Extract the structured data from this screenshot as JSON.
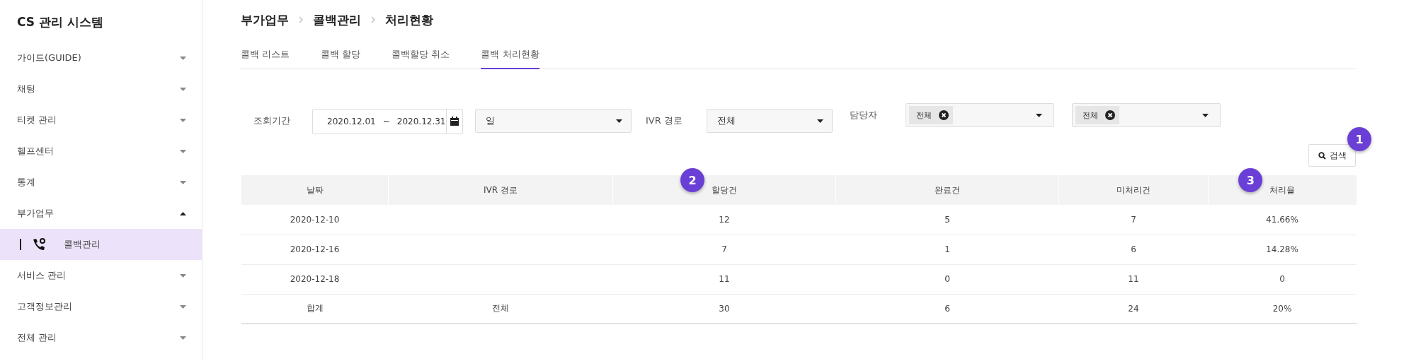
{
  "sidebar": {
    "title": "CS 관리 시스템",
    "items": [
      {
        "label": "가이드(GUIDE)",
        "expanded": false
      },
      {
        "label": "채팅",
        "expanded": false
      },
      {
        "label": "티켓 관리",
        "expanded": false
      },
      {
        "label": "헬프센터",
        "expanded": false
      },
      {
        "label": "통계",
        "expanded": false
      },
      {
        "label": "부가업무",
        "expanded": true,
        "children": [
          {
            "label": "콜백관리",
            "selected": true
          }
        ]
      },
      {
        "label": "서비스 관리",
        "expanded": false
      },
      {
        "label": "고객정보관리",
        "expanded": false
      },
      {
        "label": "전체 관리",
        "expanded": false
      }
    ]
  },
  "breadcrumb": [
    "부가업무",
    "콜백관리",
    "처리현황"
  ],
  "tabs": [
    {
      "label": "콜백 리스트",
      "selected": false
    },
    {
      "label": "콜백 할당",
      "selected": false
    },
    {
      "label": "콜백할당 취소",
      "selected": false
    },
    {
      "label": "콜백 처리현황",
      "selected": true
    }
  ],
  "filters": {
    "period_label": "조회기간",
    "date_from": "2020.12.01",
    "date_separator": "~",
    "date_to": "2020.12.31",
    "unit_select": "일",
    "ivr_label": "IVR 경로",
    "ivr_select": "전체",
    "agent_label": "담당자",
    "agent_selects": [
      {
        "tag": "전체"
      },
      {
        "tag": "전체"
      }
    ]
  },
  "search_button": {
    "label": "검색",
    "badge": "1"
  },
  "table": {
    "columns": [
      {
        "label": "날짜"
      },
      {
        "label": "IVR 경로"
      },
      {
        "label": "할당건",
        "badge": "2"
      },
      {
        "label": "완료건"
      },
      {
        "label": "미처리건"
      },
      {
        "label": "처리율",
        "badge": "3"
      }
    ],
    "rows": [
      [
        "2020-12-10",
        "",
        "12",
        "5",
        "7",
        "41.66%"
      ],
      [
        "2020-12-16",
        "",
        "7",
        "1",
        "6",
        "14.28%"
      ],
      [
        "2020-12-18",
        "",
        "11",
        "0",
        "11",
        "0"
      ],
      [
        "합계",
        "전체",
        "30",
        "6",
        "24",
        "20%"
      ]
    ]
  }
}
